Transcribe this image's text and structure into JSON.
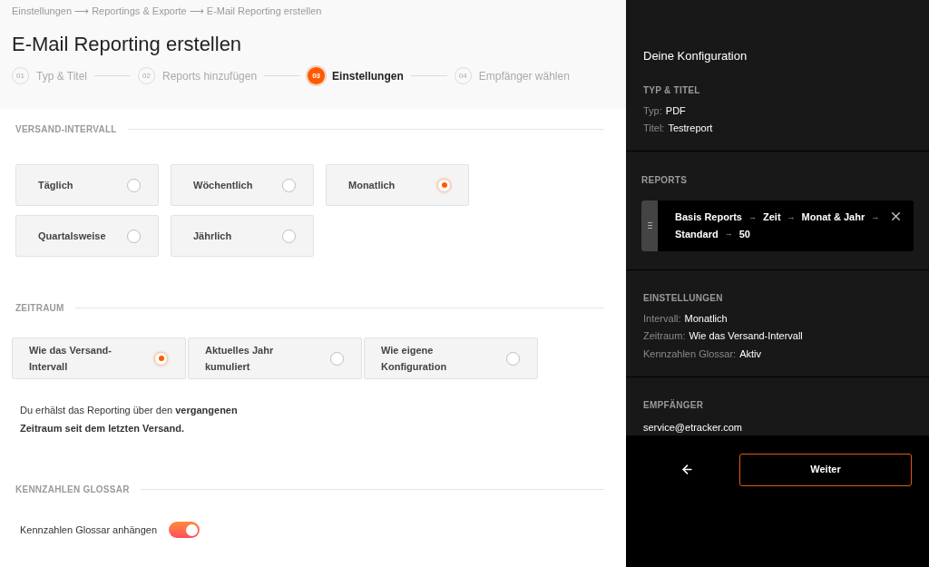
{
  "breadcrumb": "Einstellungen ⟶ Reportings & Exporte ⟶ E-Mail Reporting erstellen",
  "title": "E-Mail Reporting erstellen",
  "steps": [
    {
      "number": "01",
      "label": "Typ & Titel",
      "selected": false
    },
    {
      "number": "02",
      "label": "Reports hinzufügen",
      "selected": false
    },
    {
      "number": "03",
      "label": "Einstellungen",
      "selected": true
    },
    {
      "number": "04",
      "label": "Empfänger wählen",
      "selected": false
    }
  ],
  "interval": {
    "heading": "VERSAND-INTERVALL",
    "options": [
      {
        "label": "Täglich",
        "selected": false
      },
      {
        "label": "Wöchentlich",
        "selected": false
      },
      {
        "label": "Monatlich",
        "selected": true
      },
      {
        "label": "Quartalsweise",
        "selected": false
      },
      {
        "label": "Jährlich",
        "selected": false
      }
    ]
  },
  "period": {
    "heading": "ZEITRAUM",
    "options": [
      {
        "label": "Wie das Versand-Intervall",
        "selected": true
      },
      {
        "label": "Aktuelles Jahr kumuliert",
        "selected": false
      },
      {
        "label": "Wie eigene Konfiguration",
        "selected": false
      }
    ],
    "note": "Du erhälst das Reporting über den **vergangenen Zeitraum seit dem letzten Versand.**"
  },
  "glossary": {
    "heading": "KENNZAHLEN GLOSSAR",
    "label": "Kennzahlen Glossar anhängen",
    "on": true
  },
  "summary": {
    "title": "Deine Konfiguration",
    "type_title": {
      "heading": "TYP & TITEL",
      "lines": [
        {
          "label": "Typ:",
          "value": "PDF"
        },
        {
          "label": "Titel:",
          "value": "Testreport"
        }
      ]
    },
    "reports": {
      "heading": "REPORTS",
      "segments": [
        {
          "kind": "label",
          "text": "Basis Reports"
        },
        {
          "kind": "arrow",
          "text": "→"
        },
        {
          "kind": "label",
          "text": "Zeit"
        },
        {
          "kind": "arrow",
          "text": "→"
        },
        {
          "kind": "label",
          "text": "Monat & Jahr"
        },
        {
          "kind": "arrow",
          "text": "→"
        },
        {
          "kind": "label",
          "text": "Standard"
        },
        {
          "kind": "arrow",
          "text": "→"
        },
        {
          "kind": "label",
          "text": "50"
        }
      ]
    },
    "settings": {
      "heading": "EINSTELLUNGEN",
      "lines": [
        {
          "label": "Intervall:",
          "value": "Monatlich"
        },
        {
          "label": "Zeitraum:",
          "value": "Wie das Versand-Intervall"
        },
        {
          "label": "Kennzahlen Glossar:",
          "value": "Aktiv"
        }
      ]
    },
    "recipients": {
      "heading": "EMPFÄNGER",
      "emails": [
        "service@etracker.com"
      ]
    }
  },
  "next_button": "Weiter"
}
